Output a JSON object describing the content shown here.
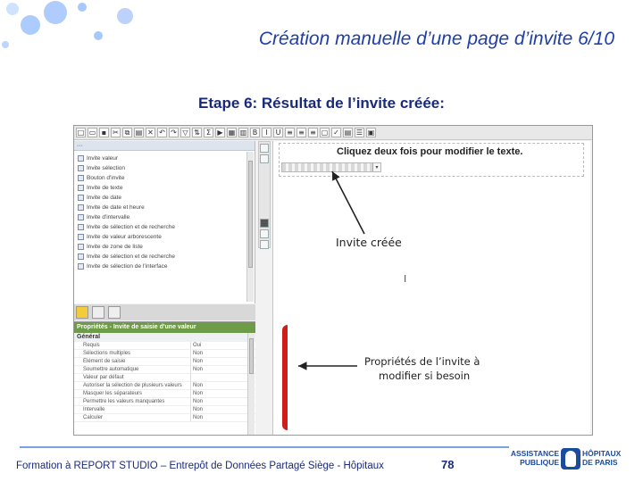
{
  "slide": {
    "title": "Création manuelle d’une page d’invite 6/10",
    "subtitle": "Etape 6: Résultat de l’invite créée:"
  },
  "screenshot": {
    "insertable_objects": [
      "Invite valeur",
      "Invite sélection",
      "Bouton d'invite",
      "Invite de texte",
      "Invite de date",
      "Invite de date et heure",
      "Invite d'intervalle",
      "Invite de sélection et de recherche",
      "Invite de valeur arborescente",
      "Invite de zone de liste",
      "Invite de sélection et de recherche",
      "Invite de sélection de l'interface"
    ],
    "properties_header": "Propriétés - Invite de saisie d'une valeur",
    "properties_group": "Général",
    "properties": [
      {
        "k": "Requis",
        "v": "Oui"
      },
      {
        "k": "Sélections multiples",
        "v": "Non"
      },
      {
        "k": "Élément de saisie",
        "v": "Non"
      },
      {
        "k": "Soumettre automatique",
        "v": "Non"
      },
      {
        "k": "Valeur par défaut",
        "v": ""
      },
      {
        "k": "Autoriser la sélection de plusieurs valeurs",
        "v": "Non"
      },
      {
        "k": "Masquer les séparateurs",
        "v": "Non"
      },
      {
        "k": "Permettre les valeurs manquantes",
        "v": "Non"
      },
      {
        "k": "Intervalle",
        "v": "Non"
      },
      {
        "k": "Calculer",
        "v": "Non"
      }
    ],
    "canvas_title": "Cliquez deux fois pour modifier le texte.",
    "annotation_prompt": "Invite créée",
    "annotation_props_line1": "Propriétés de l’invite à",
    "annotation_props_line2": "modifier si besoin"
  },
  "footer": {
    "text": "Formation à REPORT STUDIO – Entrepôt de Données Partagé Siège - Hôpitaux",
    "page_number": "78",
    "logo_left_line1": "ASSISTANCE",
    "logo_left_line2": "PUBLIQUE",
    "logo_right_line1": "HÔPITAUX",
    "logo_right_line2": "DE PARIS"
  },
  "colors": {
    "title": "#1f3fa6",
    "accent_green": "#6e9b47",
    "bracket_red": "#d11c1c",
    "footer_rule": "#7aa2dc",
    "logo_blue": "#1a4b9c"
  }
}
